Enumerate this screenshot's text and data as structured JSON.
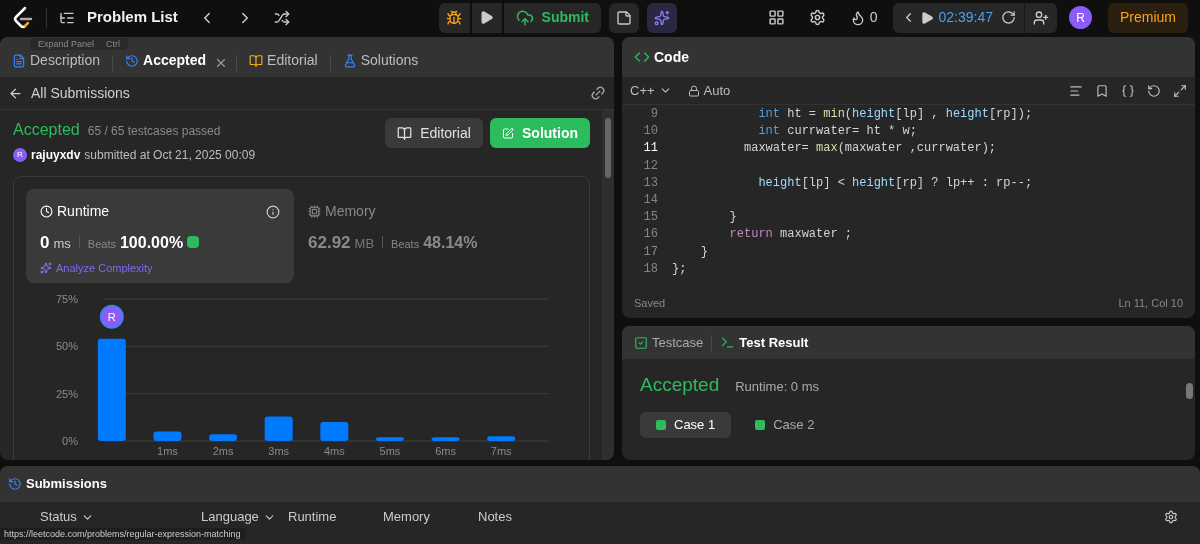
{
  "topbar": {
    "title": "Problem List",
    "submit": "Submit",
    "streak": "0",
    "timer": "02:39:47",
    "avatar": "R",
    "premium": "Premium"
  },
  "left_panel": {
    "tooltip": {
      "label": "Expand Panel",
      "shortcut": "Ctrl"
    },
    "tabs": [
      {
        "label": "Description",
        "selected": false
      },
      {
        "label": "Accepted",
        "selected": true,
        "closable": true
      },
      {
        "label": "Editorial",
        "selected": false
      },
      {
        "label": "Solutions",
        "selected": false
      }
    ],
    "back_link": "All Submissions",
    "status": "Accepted",
    "testcases": "65 / 65 testcases passed",
    "user_initial": "R",
    "user": "rajuyxdv",
    "submitted": "submitted at Oct 21, 2025 00:09",
    "buttons": [
      {
        "label": "Editorial",
        "kind": "secondary"
      },
      {
        "label": "Solution",
        "kind": "primary"
      }
    ],
    "stats": [
      {
        "title": "Runtime",
        "value": "0",
        "unit": "ms",
        "beats_label": "Beats",
        "beats": "100.00%",
        "selected": true,
        "action": "Analyze Complexity"
      },
      {
        "title": "Memory",
        "value": "62.92",
        "unit": "MB",
        "beats_label": "Beats",
        "beats": "48.14%",
        "selected": false
      }
    ],
    "chart_marker": "R",
    "chart_data": {
      "type": "bar",
      "categories": [
        null,
        "1ms",
        "2ms",
        "3ms",
        "4ms",
        "5ms",
        "6ms",
        "7ms"
      ],
      "values": [
        54,
        5,
        3.5,
        13,
        10,
        2,
        2,
        2.5
      ],
      "ylim": [
        0,
        75
      ],
      "yticks": [
        {
          "value": 0,
          "label": "0%"
        },
        {
          "value": 25,
          "label": "25%"
        },
        {
          "value": 50,
          "label": "50%"
        },
        {
          "value": 75,
          "label": "75%"
        }
      ]
    }
  },
  "code_panel": {
    "title": "Code",
    "language": "C++",
    "mode": "Auto",
    "lines": [
      {
        "number": "9",
        "current": false,
        "segments": [
          {
            "text": "            int",
            "kind": "type"
          },
          {
            "text": " ht = ",
            "kind": "plain"
          },
          {
            "text": "min",
            "kind": "func"
          },
          {
            "text": "(",
            "kind": "plain"
          },
          {
            "text": "height",
            "kind": "var"
          },
          {
            "text": "[lp] , ",
            "kind": "plain"
          },
          {
            "text": "height",
            "kind": "var"
          },
          {
            "text": "[rp]);",
            "kind": "plain"
          }
        ]
      },
      {
        "number": "10",
        "current": false,
        "segments": [
          {
            "text": "            int",
            "kind": "type"
          },
          {
            "text": " currwater= ht * w;",
            "kind": "plain"
          }
        ]
      },
      {
        "number": "11",
        "current": true,
        "segments": [
          {
            "text": "          maxwater= ",
            "kind": "plain"
          },
          {
            "text": "max",
            "kind": "func"
          },
          {
            "text": "(maxwater ,currwater);",
            "kind": "plain"
          }
        ]
      },
      {
        "number": "12",
        "current": false
      },
      {
        "number": "13",
        "current": false,
        "segments": [
          {
            "text": "            height",
            "kind": "var"
          },
          {
            "text": "[lp] < ",
            "kind": "plain"
          },
          {
            "text": "height",
            "kind": "var"
          },
          {
            "text": "[rp] ? lp++ : rp--;",
            "kind": "plain"
          }
        ]
      },
      {
        "number": "14",
        "current": false
      },
      {
        "number": "15",
        "current": false,
        "segments": [
          {
            "text": "        }",
            "kind": "plain"
          }
        ]
      },
      {
        "number": "16",
        "current": false,
        "segments": [
          {
            "text": "        return",
            "kind": "keyword"
          },
          {
            "text": " maxwater ;",
            "kind": "plain"
          }
        ]
      },
      {
        "number": "17",
        "current": false,
        "segments": [
          {
            "text": "    }",
            "kind": "plain"
          }
        ]
      },
      {
        "number": "18",
        "current": false,
        "segments": [
          {
            "text": "};",
            "kind": "plain"
          }
        ]
      }
    ],
    "saved": "Saved",
    "cursor": "Ln 11, Col 10"
  },
  "result_panel": {
    "tabs": [
      {
        "label": "Testcase",
        "selected": false
      },
      {
        "label": "Test Result",
        "selected": true
      }
    ],
    "status": "Accepted",
    "runtime": "Runtime: 0 ms",
    "cases": [
      {
        "label": "Case 1",
        "selected": true
      },
      {
        "label": "Case 2",
        "selected": false
      }
    ]
  },
  "submissions_panel": {
    "title": "Submissions",
    "columns": [
      {
        "label": "Status",
        "dropdown": true
      },
      {
        "label": "Language",
        "dropdown": true
      },
      {
        "label": "Runtime"
      },
      {
        "label": "Memory"
      },
      {
        "label": "Notes"
      }
    ]
  },
  "status_bar": {
    "url": "https://leetcode.com/problems/regular-expression-matching"
  }
}
